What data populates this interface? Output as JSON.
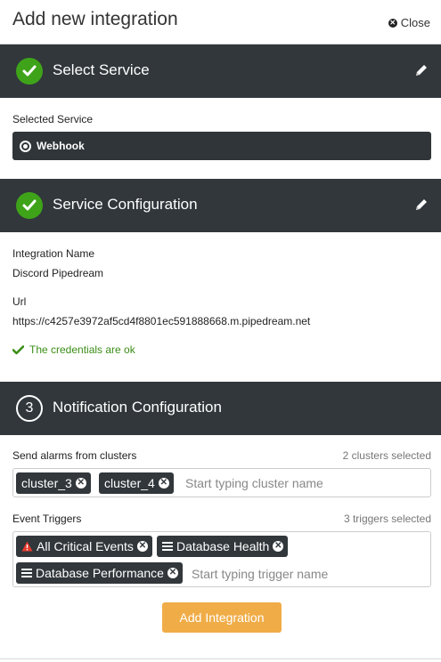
{
  "header": {
    "title": "Add new integration",
    "close_label": "Close"
  },
  "section1": {
    "title": "Select Service",
    "selected_label": "Selected Service",
    "service": "Webhook"
  },
  "section2": {
    "title": "Service Configuration",
    "name_label": "Integration Name",
    "name_value": "Discord Pipedream",
    "url_label": "Url",
    "url_value": "https://c4257e3972af5cd4f8801ec591888668.m.pipedream.net",
    "credentials_msg": "The credentials are ok"
  },
  "section3": {
    "step": "3",
    "title": "Notification Configuration",
    "clusters_label": "Send alarms from clusters",
    "clusters_count": "2 clusters selected",
    "clusters": [
      "cluster_3",
      "cluster_4"
    ],
    "clusters_placeholder": "Start typing cluster name",
    "triggers_label": "Event Triggers",
    "triggers_count": "3 triggers selected",
    "triggers": [
      "All Critical Events",
      "Database Health",
      "Database Performance"
    ],
    "triggers_placeholder": "Start typing trigger name"
  },
  "actions": {
    "add_label": "Add Integration"
  },
  "colors": {
    "accent": "#f0ac47",
    "success": "#3fa31a",
    "dark": "#31373b",
    "warning": "#e63b2e"
  }
}
